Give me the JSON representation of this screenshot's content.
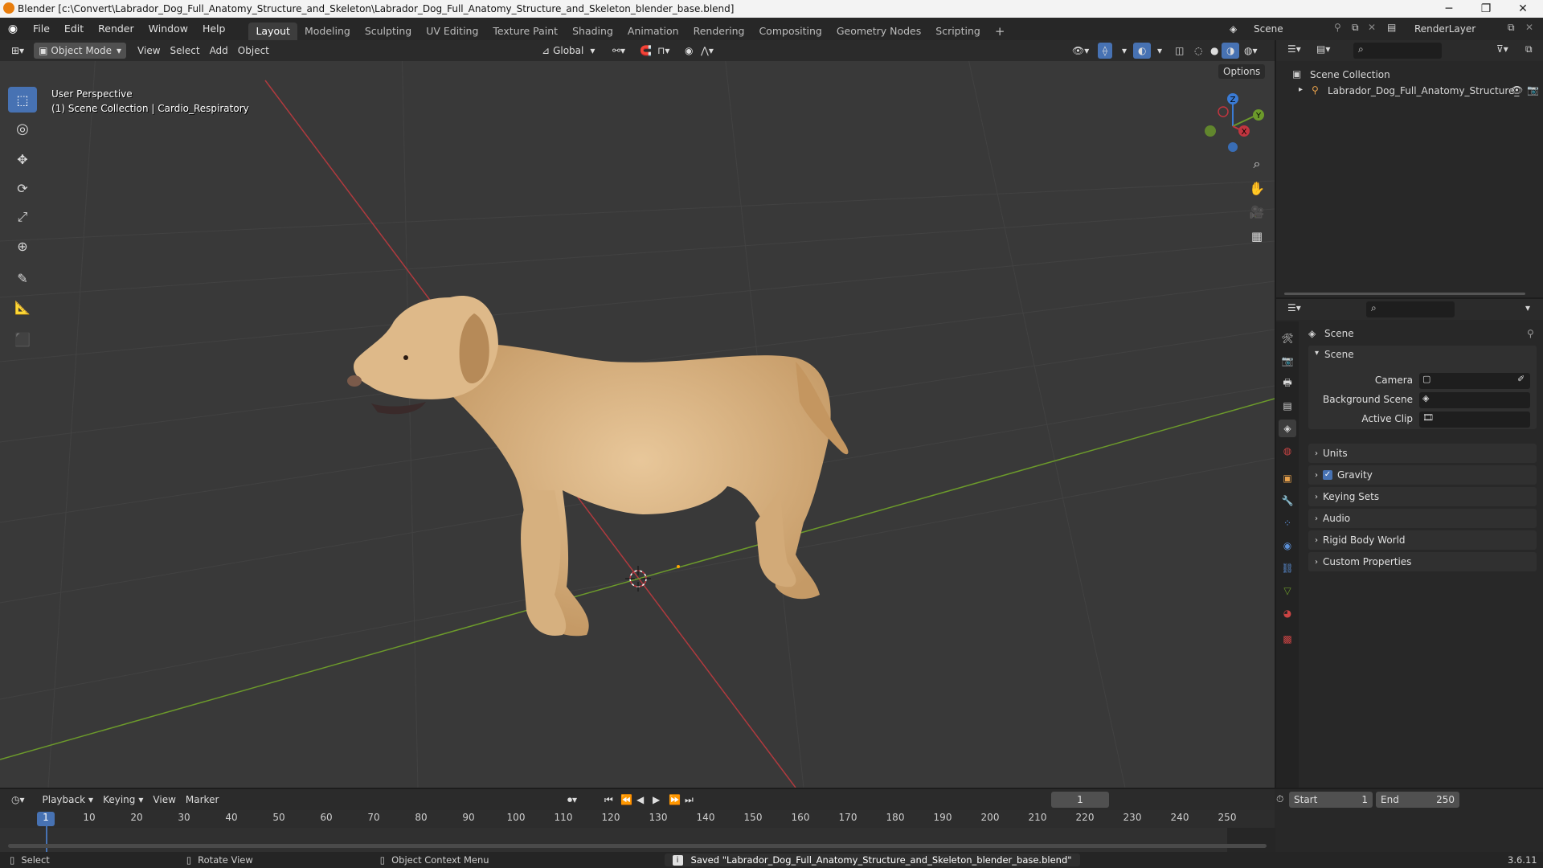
{
  "window": {
    "title": "Blender [c:\\Convert\\Labrador_Dog_Full_Anatomy_Structure_and_Skeleton\\Labrador_Dog_Full_Anatomy_Structure_and_Skeleton_blender_base.blend]",
    "minimize": "─",
    "maximize": "❐",
    "close": "✕"
  },
  "menus": [
    "File",
    "Edit",
    "Render",
    "Window",
    "Help"
  ],
  "workspaces": [
    "Layout",
    "Modeling",
    "Sculpting",
    "UV Editing",
    "Texture Paint",
    "Shading",
    "Animation",
    "Rendering",
    "Compositing",
    "Geometry Nodes",
    "Scripting"
  ],
  "workspace_add": "+",
  "scene_name": "Scene",
  "view_layer": "RenderLayer",
  "viewport_header": {
    "mode": "Object Mode",
    "menus": [
      "View",
      "Select",
      "Add",
      "Object"
    ],
    "orientation": "Global",
    "options": "Options"
  },
  "viewport": {
    "perspective": "User Perspective",
    "collection": "(1) Scene Collection | Cardio_Respiratory",
    "gizmo": {
      "x": "X",
      "y": "Y",
      "z": "Z"
    }
  },
  "outliner": {
    "root": "Scene Collection",
    "item": "Labrador_Dog_Full_Anatomy_Structure_"
  },
  "properties": {
    "header": "Scene",
    "section": "Scene",
    "fields": [
      {
        "label": "Camera"
      },
      {
        "label": "Background Scene"
      },
      {
        "label": "Active Clip"
      }
    ],
    "panels": [
      "Units",
      "Gravity",
      "Keying Sets",
      "Audio",
      "Rigid Body World",
      "Custom Properties"
    ],
    "gravity_checked": true
  },
  "timeline": {
    "menus": [
      "Playback",
      "Keying",
      "View",
      "Marker"
    ],
    "current_frame": "1",
    "start_label": "Start",
    "start": "1",
    "end_label": "End",
    "end": "250",
    "ticks": [
      "1",
      "10",
      "20",
      "30",
      "40",
      "50",
      "60",
      "70",
      "80",
      "90",
      "100",
      "110",
      "120",
      "130",
      "140",
      "150",
      "160",
      "170",
      "180",
      "190",
      "200",
      "210",
      "220",
      "230",
      "240",
      "250"
    ]
  },
  "statusbar": {
    "select": "Select",
    "rotate": "Rotate View",
    "context": "Object Context Menu",
    "message": "Saved \"Labrador_Dog_Full_Anatomy_Structure_and_Skeleton_blender_base.blend\"",
    "version": "3.6.11"
  },
  "colors": {
    "accent": "#4772b3",
    "x_axis": "#c0353f",
    "y_axis": "#6c9a2b",
    "z_axis": "#3a7bd5",
    "dog_fur": "#d9b586"
  }
}
